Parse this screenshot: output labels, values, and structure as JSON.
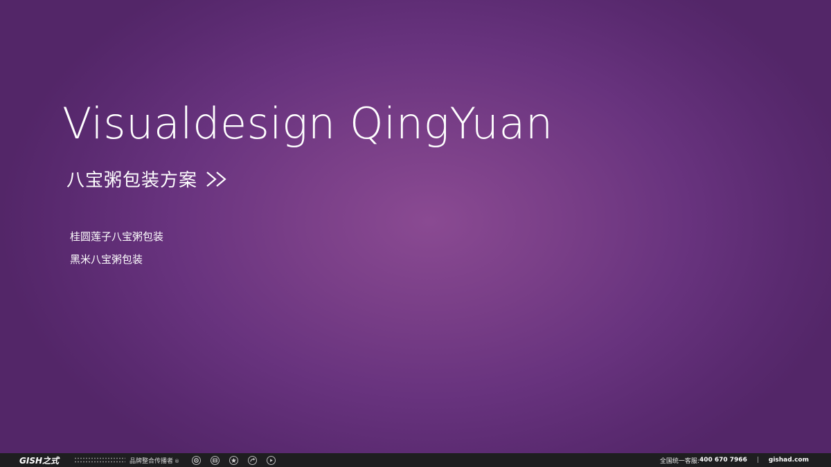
{
  "slide": {
    "title": "Visualdesign QingYuan",
    "subtitle": "八宝粥包装方案",
    "chevron_icon": "double-chevron-right-icon",
    "items": [
      {
        "label": "桂圆莲子八宝粥包装"
      },
      {
        "label": "黑米八宝粥包装"
      }
    ],
    "colors": {
      "background_center": "#8a4a92",
      "background_edge": "#532668",
      "text": "#ffffff"
    }
  },
  "footer": {
    "logo": "GISH之式",
    "slogan": "品牌整合传播者",
    "registered_mark": "®",
    "icons": [
      "refresh-icon",
      "grid-icon",
      "star-icon",
      "share-icon",
      "play-icon"
    ],
    "hotline_label": "全国统一客服:",
    "hotline_number": "400 670 7966",
    "separator": "|",
    "website": "gishad.com",
    "colors": {
      "bar": "#1e1e20",
      "text": "#dcdcdc"
    }
  }
}
